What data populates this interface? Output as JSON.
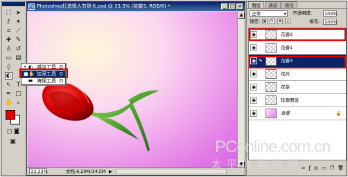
{
  "document": {
    "title": "Photoshop打造情人节贺卡.psd @ 33.3% (花瓣3, RGB/8) *",
    "zoom": "33.33%",
    "doc_size": "文档:6.20M/14.5M",
    "nav_arrow": "▶"
  },
  "window_buttons": [
    "_",
    "□",
    "×"
  ],
  "flyout": {
    "items": [
      {
        "label": "减淡工具",
        "key": "O",
        "icon": "dodge-icon",
        "dot": "•"
      },
      {
        "label": "加深工具",
        "key": "O",
        "icon": "burn-icon",
        "dot": "■"
      },
      {
        "label": "海绵工具",
        "key": "O",
        "icon": "sponge-icon",
        "dot": ""
      }
    ]
  },
  "layers_panel": {
    "tabs": [
      "图层",
      "通道",
      "路径"
    ],
    "blend_mode": "正常",
    "opacity_label": "不透明度:",
    "opacity_value": "100%",
    "lock_label": "锁定:",
    "fill_label": "填充:",
    "fill_value": "100%",
    "layers": [
      {
        "name": "花瓣2",
        "selected": false,
        "background": false
      },
      {
        "name": "花瓣1",
        "selected": false,
        "background": false
      },
      {
        "name": "花瓣3",
        "selected": true,
        "background": false
      },
      {
        "name": "花托",
        "selected": false,
        "background": false
      },
      {
        "name": "花茎",
        "selected": false,
        "background": false
      },
      {
        "name": "轮廓图层",
        "selected": false,
        "background": false
      },
      {
        "name": "背景",
        "selected": false,
        "background": true
      }
    ]
  },
  "colors": {
    "foreground": "#e00000",
    "background": "#ffffff",
    "highlight": "#e00000",
    "selection": "#0a246a"
  },
  "watermark": {
    "line1": "PConline.com.cn",
    "line2": "太平洋电脑网"
  }
}
